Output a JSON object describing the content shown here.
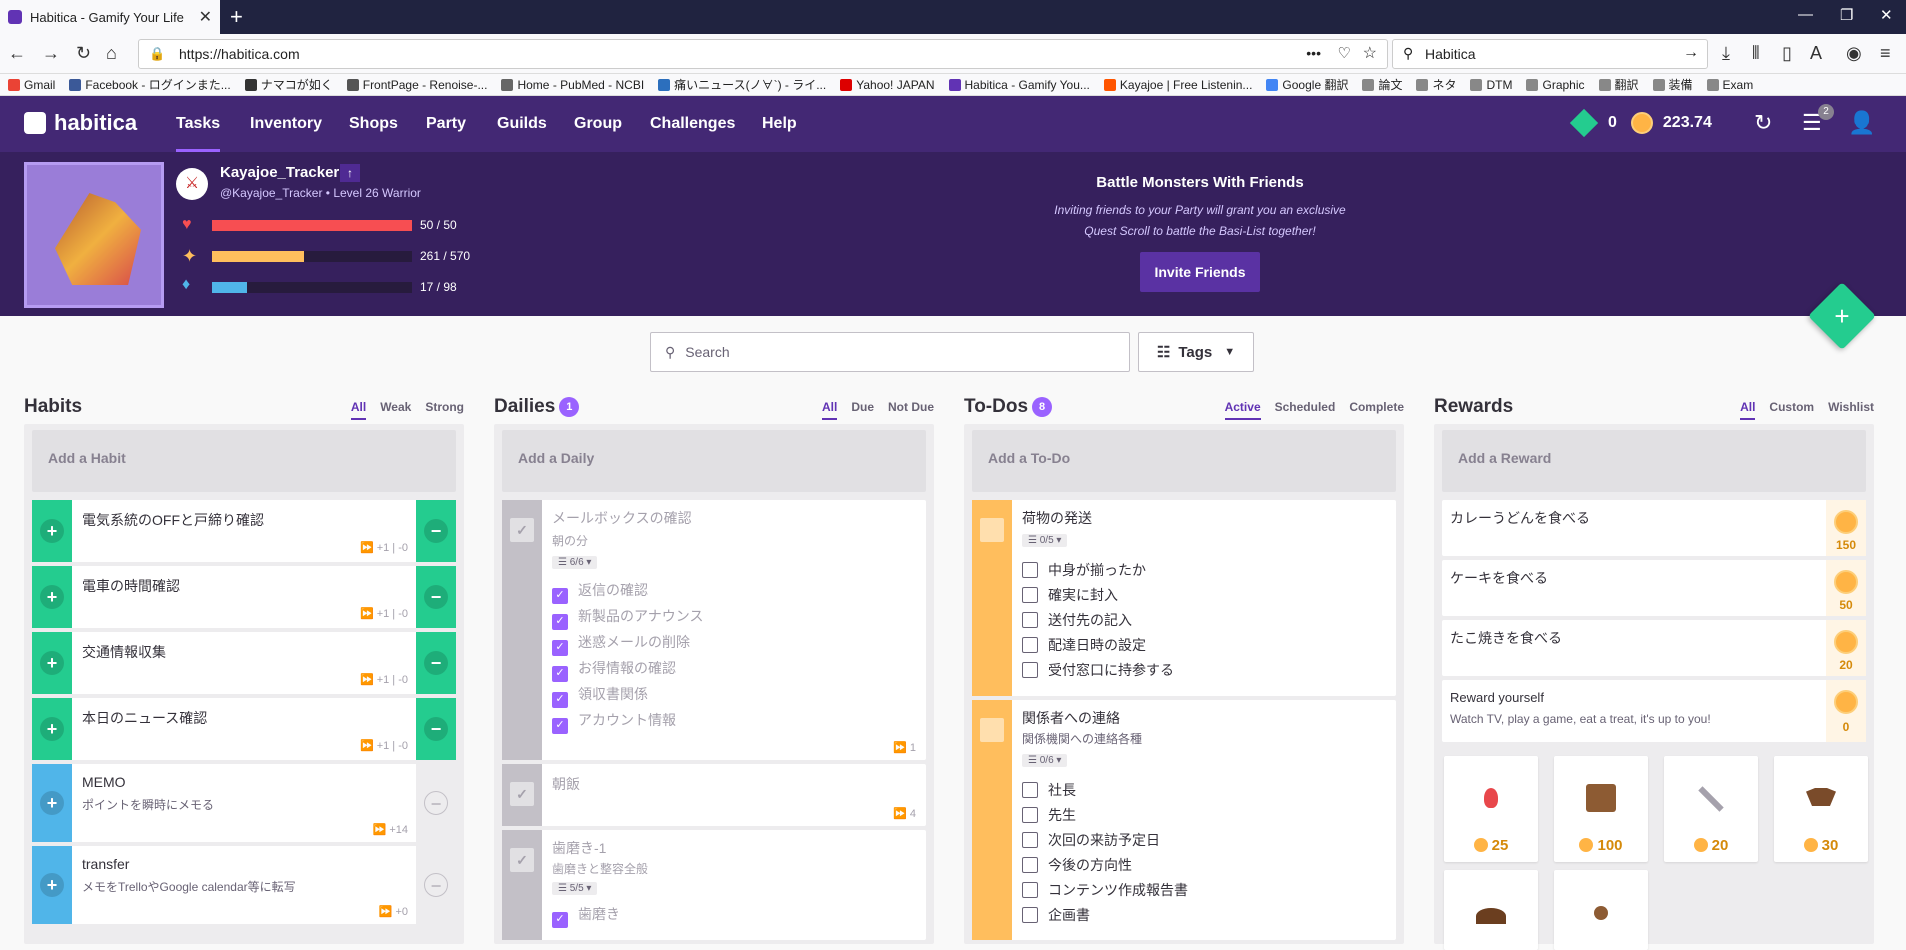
{
  "browser": {
    "tab_title": "Habitica - Gamify Your Life",
    "url": "https://habitica.com",
    "search_value": "Habitica",
    "bookmarks": [
      "Gmail",
      "Facebook - ログインまた...",
      "ナマコが如く",
      "FrontPage - Renoise-...",
      "Home - PubMed - NCBI",
      "痛いニュース(ノ∀`) - ライ...",
      "Yahoo! JAPAN",
      "Habitica - Gamify You...",
      "Kayajoe | Free Listenin...",
      "Google 翻訳",
      "論文",
      "ネタ",
      "DTM",
      "Graphic",
      "翻訳",
      "装備",
      "Exam"
    ]
  },
  "nav": {
    "logo": "habitica",
    "menu": [
      "Tasks",
      "Inventory",
      "Shops",
      "Party",
      "Guilds",
      "Group",
      "Challenges",
      "Help"
    ],
    "gems": "0",
    "gold": "223.74",
    "notif_count": "2"
  },
  "profile": {
    "username": "Kayajoe_Tracker",
    "handle": "@Kayajoe_Tracker • Level 26 Warrior",
    "hp": {
      "label": "50 / 50",
      "value": 50,
      "max": 50
    },
    "xp": {
      "label": "261 / 570",
      "value": 261,
      "max": 570
    },
    "mp": {
      "label": "17 / 98",
      "value": 17,
      "max": 98
    },
    "party_title": "Battle Monsters With Friends",
    "party_line1": "Inviting friends to your Party will grant you an exclusive",
    "party_line2": "Quest Scroll to battle the Basi-List together!",
    "invite_label": "Invite Friends"
  },
  "toolbar": {
    "search_placeholder": "Search",
    "tags_label": "Tags"
  },
  "habits": {
    "title": "Habits",
    "filters": [
      "All",
      "Weak",
      "Strong"
    ],
    "add": "Add a Habit",
    "items": [
      {
        "text": "電気系統のOFFと戸締り確認",
        "meta": "⏩ +1 | -0"
      },
      {
        "text": "電車の時間確認",
        "meta": "⏩ +1 | -0"
      },
      {
        "text": "交通情報収集",
        "meta": "⏩ +1 | -0"
      },
      {
        "text": "本日のニュース確認",
        "meta": "⏩ +1 | -0"
      },
      {
        "text": "MEMO",
        "note": "ポイントを瞬時にメモる",
        "meta": "⏩ +14"
      },
      {
        "text": "transfer",
        "note": "メモをTrelloやGoogle calendar等に転写",
        "meta": "⏩ +0"
      }
    ]
  },
  "dailies": {
    "title": "Dailies",
    "badge": "1",
    "filters": [
      "All",
      "Due",
      "Not Due"
    ],
    "add": "Add a Daily",
    "items": [
      {
        "text": "メールボックスの確認",
        "note": "朝の分",
        "checklist_count": "6/6",
        "checklist": [
          "返信の確認",
          "新製品のアナウンス",
          "迷惑メールの削除",
          "お得情報の確認",
          "領収書関係",
          "アカウント情報"
        ],
        "meta": "⏩ 1"
      },
      {
        "text": "朝飯",
        "meta": "⏩ 4"
      },
      {
        "text": "歯磨き-1",
        "note": "歯磨きと整容全般",
        "checklist_count": "5/5",
        "checklist": [
          "歯磨き"
        ]
      }
    ]
  },
  "todos": {
    "title": "To-Dos",
    "badge": "8",
    "filters": [
      "Active",
      "Scheduled",
      "Complete"
    ],
    "add": "Add a To-Do",
    "items": [
      {
        "text": "荷物の発送",
        "checklist_count": "0/5",
        "checklist": [
          "中身が揃ったか",
          "確実に封入",
          "送付先の記入",
          "配達日時の設定",
          "受付窓口に持参する"
        ]
      },
      {
        "text": "関係者への連絡",
        "note": "関係機関への連絡各種",
        "checklist_count": "0/6",
        "checklist": [
          "社長",
          "先生",
          "次回の来訪予定日",
          "今後の方向性",
          "コンテンツ作成報告書",
          "企画書"
        ]
      }
    ]
  },
  "rewards": {
    "title": "Rewards",
    "filters": [
      "All",
      "Custom",
      "Wishlist"
    ],
    "add": "Add a Reward",
    "items": [
      {
        "text": "カレーうどんを食べる",
        "price": "150"
      },
      {
        "text": "ケーキを食べる",
        "price": "50"
      },
      {
        "text": "たこ焼きを食べる",
        "price": "20"
      },
      {
        "text": "Reward yourself",
        "note": "Watch TV, play a game, eat a treat, it's up to you!",
        "price": "0"
      }
    ],
    "shop": [
      {
        "icon": "health-potion-icon",
        "price": "25",
        "color": "#e8474b"
      },
      {
        "icon": "treasure-chest-icon",
        "price": "100",
        "color": "#8d5b33"
      },
      {
        "icon": "sword-icon",
        "price": "20",
        "color": "#a5a1ac"
      },
      {
        "icon": "armor-icon",
        "price": "30",
        "color": "#7a4b2a"
      }
    ]
  },
  "colors": {
    "purple": "#432874",
    "habit_green": "#24cc8f",
    "habit_blue": "#50b5e9",
    "todo_orange": "#ffbe5d",
    "gray": "#c3c0c7"
  }
}
